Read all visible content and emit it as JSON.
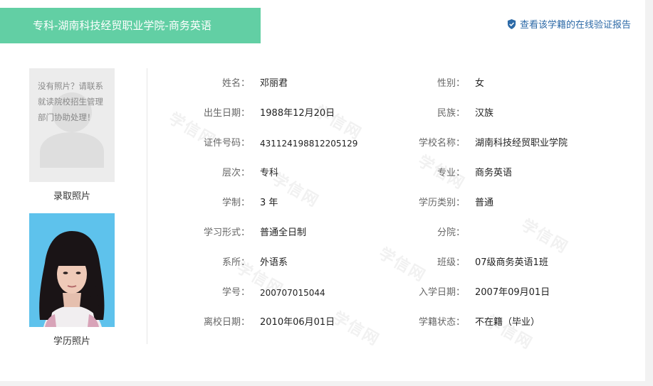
{
  "header": {
    "title": "专科-湖南科技经贸职业学院-商务英语",
    "verify_link": "查看该学籍的在线验证报告"
  },
  "photos": {
    "no_photo_message": "没有照片？请联系就读院校招生管理部门协助处理！",
    "admission_label": "录取照片",
    "education_label": "学历照片"
  },
  "watermark_text": "学信网",
  "fields": {
    "left": [
      {
        "label": "姓名：",
        "value": "邓丽君"
      },
      {
        "label": "出生日期：",
        "value": "1988年12月20日"
      },
      {
        "label": "证件号码：",
        "value": "431124198812205129"
      },
      {
        "label": "层次：",
        "value": "专科"
      },
      {
        "label": "学制：",
        "value": "3 年"
      },
      {
        "label": "学习形式：",
        "value": "普通全日制"
      },
      {
        "label": "系所：",
        "value": "外语系"
      },
      {
        "label": "学号：",
        "value": "200707015044"
      },
      {
        "label": "离校日期：",
        "value": "2010年06月01日"
      }
    ],
    "right": [
      {
        "label": "性别：",
        "value": "女"
      },
      {
        "label": "民族：",
        "value": "汉族"
      },
      {
        "label": "学校名称：",
        "value": "湖南科技经贸职业学院"
      },
      {
        "label": "专业：",
        "value": "商务英语"
      },
      {
        "label": "学历类别：",
        "value": "普通"
      },
      {
        "label": "分院：",
        "value": ""
      },
      {
        "label": "班级：",
        "value": "07级商务英语1班"
      },
      {
        "label": "入学日期：",
        "value": "2007年09月01日"
      },
      {
        "label": "学籍状态：",
        "value": "不在籍（毕业）"
      }
    ]
  },
  "colors": {
    "banner": "#62cfa4",
    "link": "#2d6aa7"
  }
}
